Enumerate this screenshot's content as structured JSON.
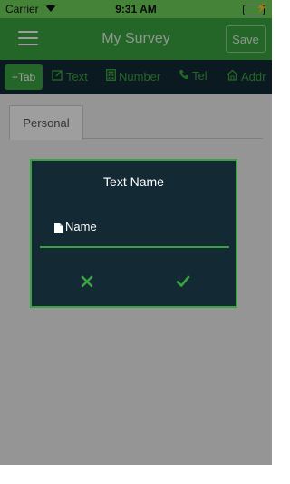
{
  "status": {
    "carrier": "Carrier",
    "time": "9:31 AM"
  },
  "nav": {
    "title": "My Survey",
    "save_label": "Save"
  },
  "toolbar": {
    "add_tab_label": "+Tab",
    "items": [
      {
        "label": "Text",
        "icon": "edit-icon"
      },
      {
        "label": "Number",
        "icon": "calculator-icon"
      },
      {
        "label": "Tel",
        "icon": "phone-icon"
      },
      {
        "label": "Addr",
        "icon": "home-icon"
      }
    ]
  },
  "tabs": [
    {
      "label": "Personal"
    }
  ],
  "dialog": {
    "title": "Text Name",
    "placeholder": "Name"
  },
  "colors": {
    "accent": "#3aa341",
    "status_bar": "#6fd35b",
    "dark": "#132a35"
  }
}
